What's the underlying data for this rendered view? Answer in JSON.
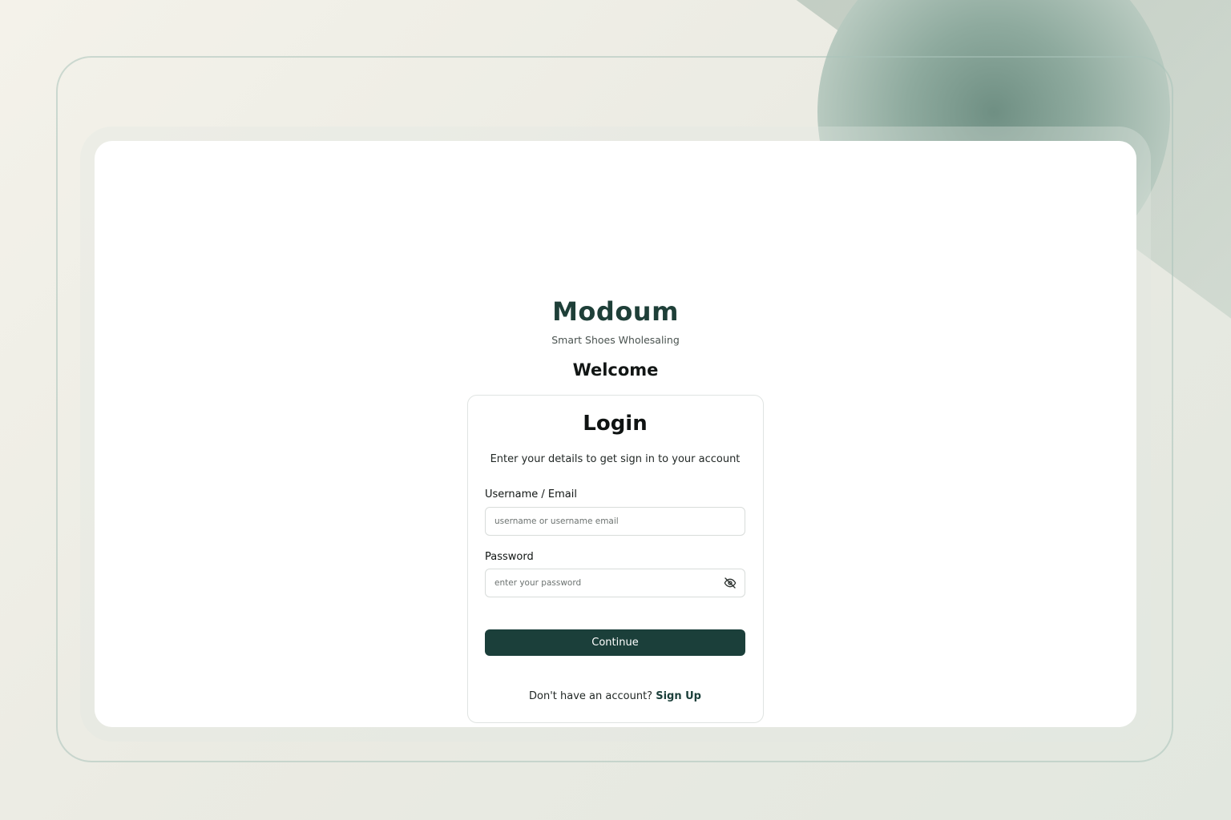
{
  "brand": {
    "name": "Modoum",
    "tagline": "Smart Shoes Wholesaling"
  },
  "welcome": "Welcome",
  "login": {
    "title": "Login",
    "subtitle": "Enter your details to get sign in to your account",
    "username": {
      "label": "Username / Email",
      "placeholder": "username or username email",
      "value": ""
    },
    "password": {
      "label": "Password",
      "placeholder": "enter your password",
      "value": "",
      "toggle_icon": "eye-off-icon"
    },
    "continue_label": "Continue",
    "signup_prompt": "Don't have an account?",
    "signup_link": "Sign Up"
  },
  "colors": {
    "brand": "#1e3f38",
    "button": "#1b3f3a",
    "background": "#ebebe3"
  }
}
